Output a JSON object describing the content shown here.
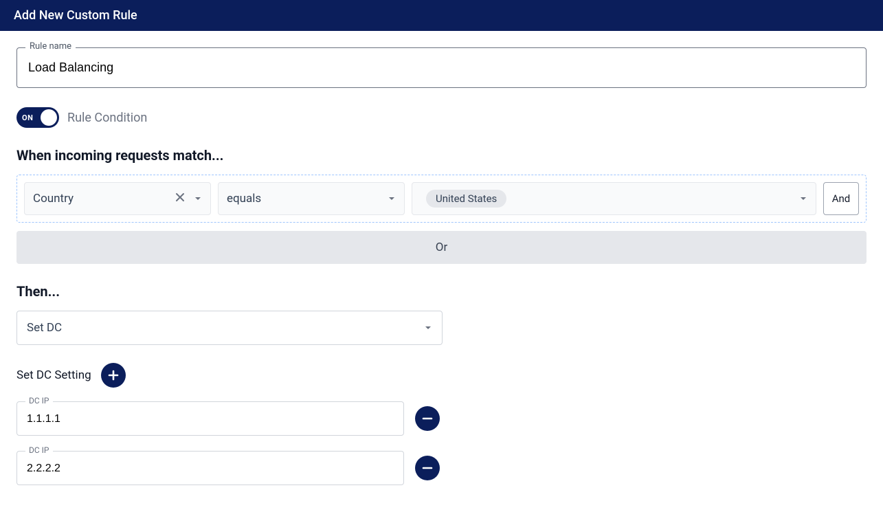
{
  "header": {
    "title": "Add New Custom Rule"
  },
  "rule_name": {
    "label": "Rule name",
    "value": "Load Balancing"
  },
  "toggle": {
    "state_text": "ON",
    "label": "Rule Condition"
  },
  "when": {
    "title": "When incoming requests match...",
    "field": "Country",
    "operator": "equals",
    "value_chip": "United States",
    "and_btn": "And",
    "or_btn": "Or"
  },
  "then": {
    "title": "Then...",
    "action": "Set DC"
  },
  "dc": {
    "setting_label": "Set DC Setting",
    "entries": [
      {
        "label": "DC IP",
        "value": "1.1.1.1"
      },
      {
        "label": "DC IP",
        "value": "2.2.2.2"
      }
    ]
  }
}
